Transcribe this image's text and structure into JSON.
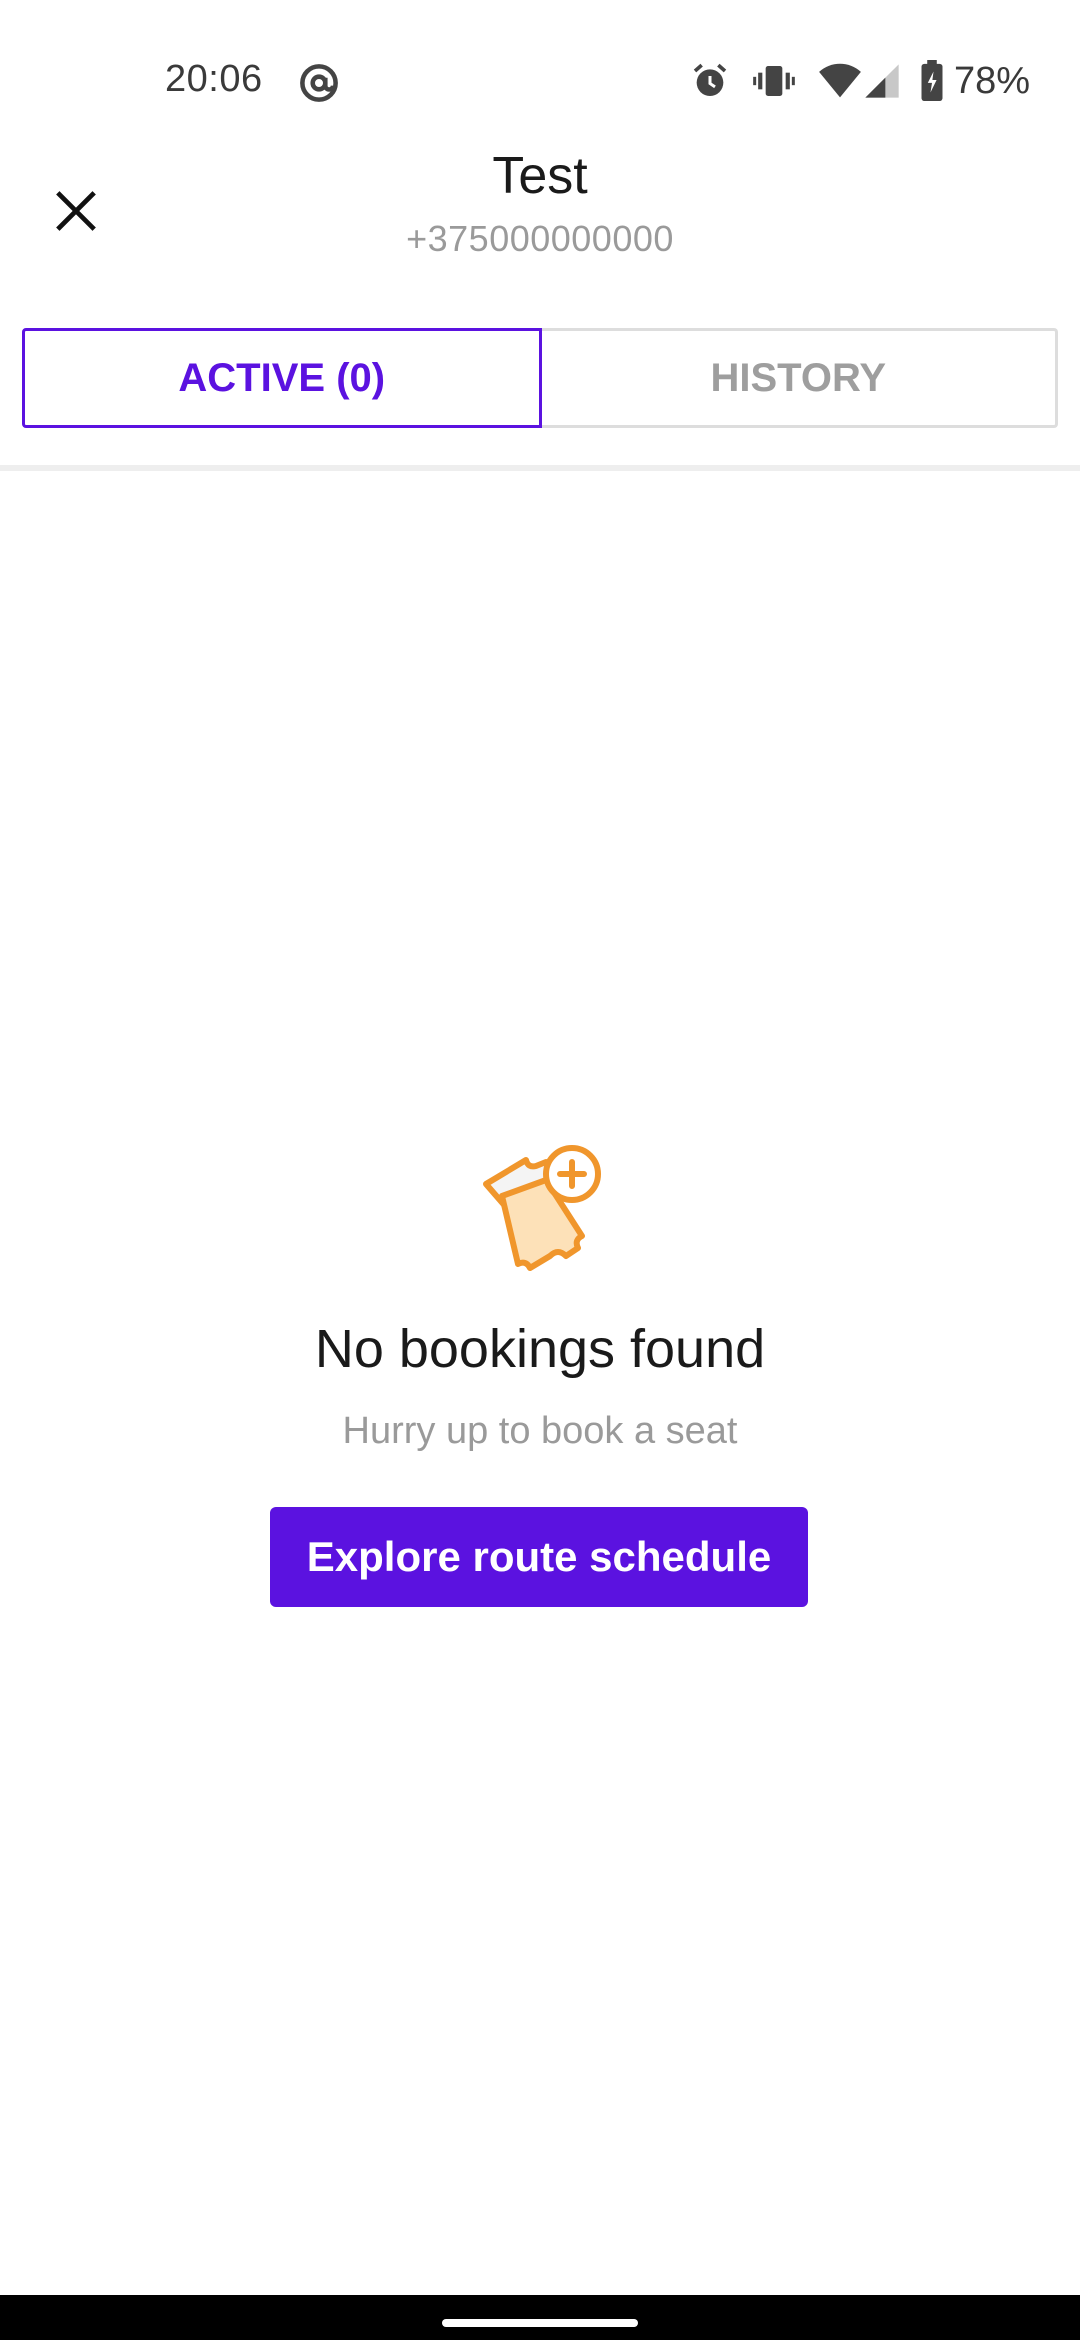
{
  "status_bar": {
    "time": "20:06",
    "battery": "78%",
    "icons": [
      "at-sign-icon",
      "alarm-icon",
      "vibrate-icon",
      "wifi-icon",
      "signal-icon",
      "battery-icon"
    ]
  },
  "header": {
    "title": "Test",
    "phone": "+375000000000",
    "close_icon": "close-icon"
  },
  "tabs": [
    {
      "label": "ACTIVE (0)",
      "active": true
    },
    {
      "label": "HISTORY",
      "active": false
    }
  ],
  "empty_state": {
    "icon": "ticket-add-icon",
    "title": "No bookings found",
    "subtitle": "Hurry up to book a seat",
    "button_label": "Explore route schedule"
  },
  "colors": {
    "accent": "#5b12e0",
    "icon_orange": "#f0962c",
    "icon_light": "#fde1b8",
    "muted_text": "#9a9a9a"
  }
}
